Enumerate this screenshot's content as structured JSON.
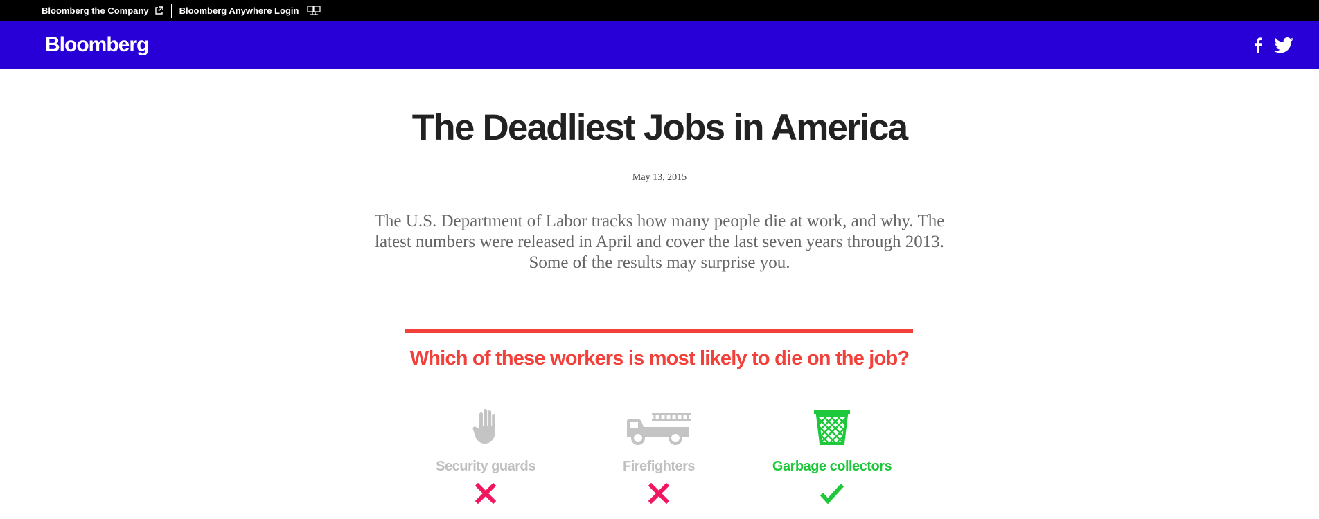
{
  "topbar": {
    "company_link": "Bloomberg the Company",
    "company_icon": "external-link-icon",
    "anywhere_link": "Bloomberg Anywhere Login",
    "anywhere_icon": "terminal-icon"
  },
  "header": {
    "logo": "Bloomberg",
    "social": [
      "facebook-icon",
      "twitter-icon"
    ],
    "brand_color": "#2800d7"
  },
  "article": {
    "title": "The Deadliest Jobs in America",
    "date": "May 13, 2015",
    "dek": "The U.S. Department of Labor tracks how many people die at work, and why. The latest numbers were released in April and cover the last seven years through 2013. Some of the results may surprise you."
  },
  "quiz": {
    "question": "Which of these workers is most likely to die on the job?",
    "accent_color": "#f2403a",
    "options": [
      {
        "label": "Security guards",
        "icon": "hand-icon",
        "result": "incorrect",
        "result_icon": "x-mark-icon"
      },
      {
        "label": "Firefighters",
        "icon": "fire-truck-icon",
        "result": "incorrect",
        "result_icon": "x-mark-icon"
      },
      {
        "label": "Garbage collectors",
        "icon": "trash-can-icon",
        "result": "correct",
        "result_icon": "check-mark-icon"
      }
    ],
    "colors": {
      "incorrect_mark": "#f0175f",
      "correct": "#1dc83a",
      "muted": "#c0c0c0"
    }
  }
}
